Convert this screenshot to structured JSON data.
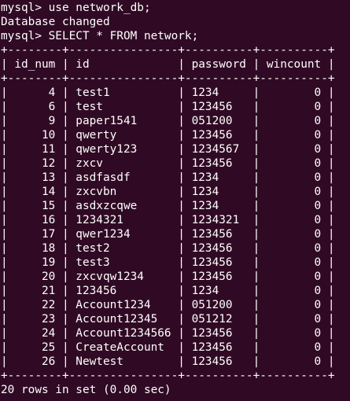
{
  "terminal": {
    "colors": {
      "background": "#300a24",
      "foreground": "#ffffff"
    },
    "lines": [
      "mysql> use network_db;",
      "Database changed",
      "mysql> SELECT * FROM network;",
      "+--------+----------------+----------+----------+",
      "| id_num | id             | password | wincount |",
      "+--------+----------------+----------+----------+",
      "|      4 | test1          | 1234     |        0 |",
      "|      6 | test           | 123456   |        0 |",
      "|      9 | paper1541      | 051200   |        0 |",
      "|     10 | qwerty         | 123456   |        0 |",
      "|     11 | qwerty123      | 1234567  |        0 |",
      "|     12 | zxcv           | 123456   |        0 |",
      "|     13 | asdfasdf       | 1234     |        0 |",
      "|     14 | zxcvbn         | 1234     |        0 |",
      "|     15 | asdxzcqwe      | 1234     |        0 |",
      "|     16 | 1234321        | 1234321  |        0 |",
      "|     17 | qwer1234       | 123456   |        0 |",
      "|     18 | test2          | 123456   |        0 |",
      "|     19 | test3          | 123456   |        0 |",
      "|     20 | zxcvqw1234     | 123456   |        0 |",
      "|     21 | 123456         | 1234     |        0 |",
      "|     22 | Account1234    | 051200   |        0 |",
      "|     23 | Account12345   | 051212   |        0 |",
      "|     24 | Account1234566 | 123456   |        0 |",
      "|     25 | CreateAccount  | 123456   |        0 |",
      "|     26 | Newtest        | 123456   |        0 |",
      "+--------+----------------+----------+----------+",
      "20 rows in set (0.00 sec)"
    ]
  }
}
